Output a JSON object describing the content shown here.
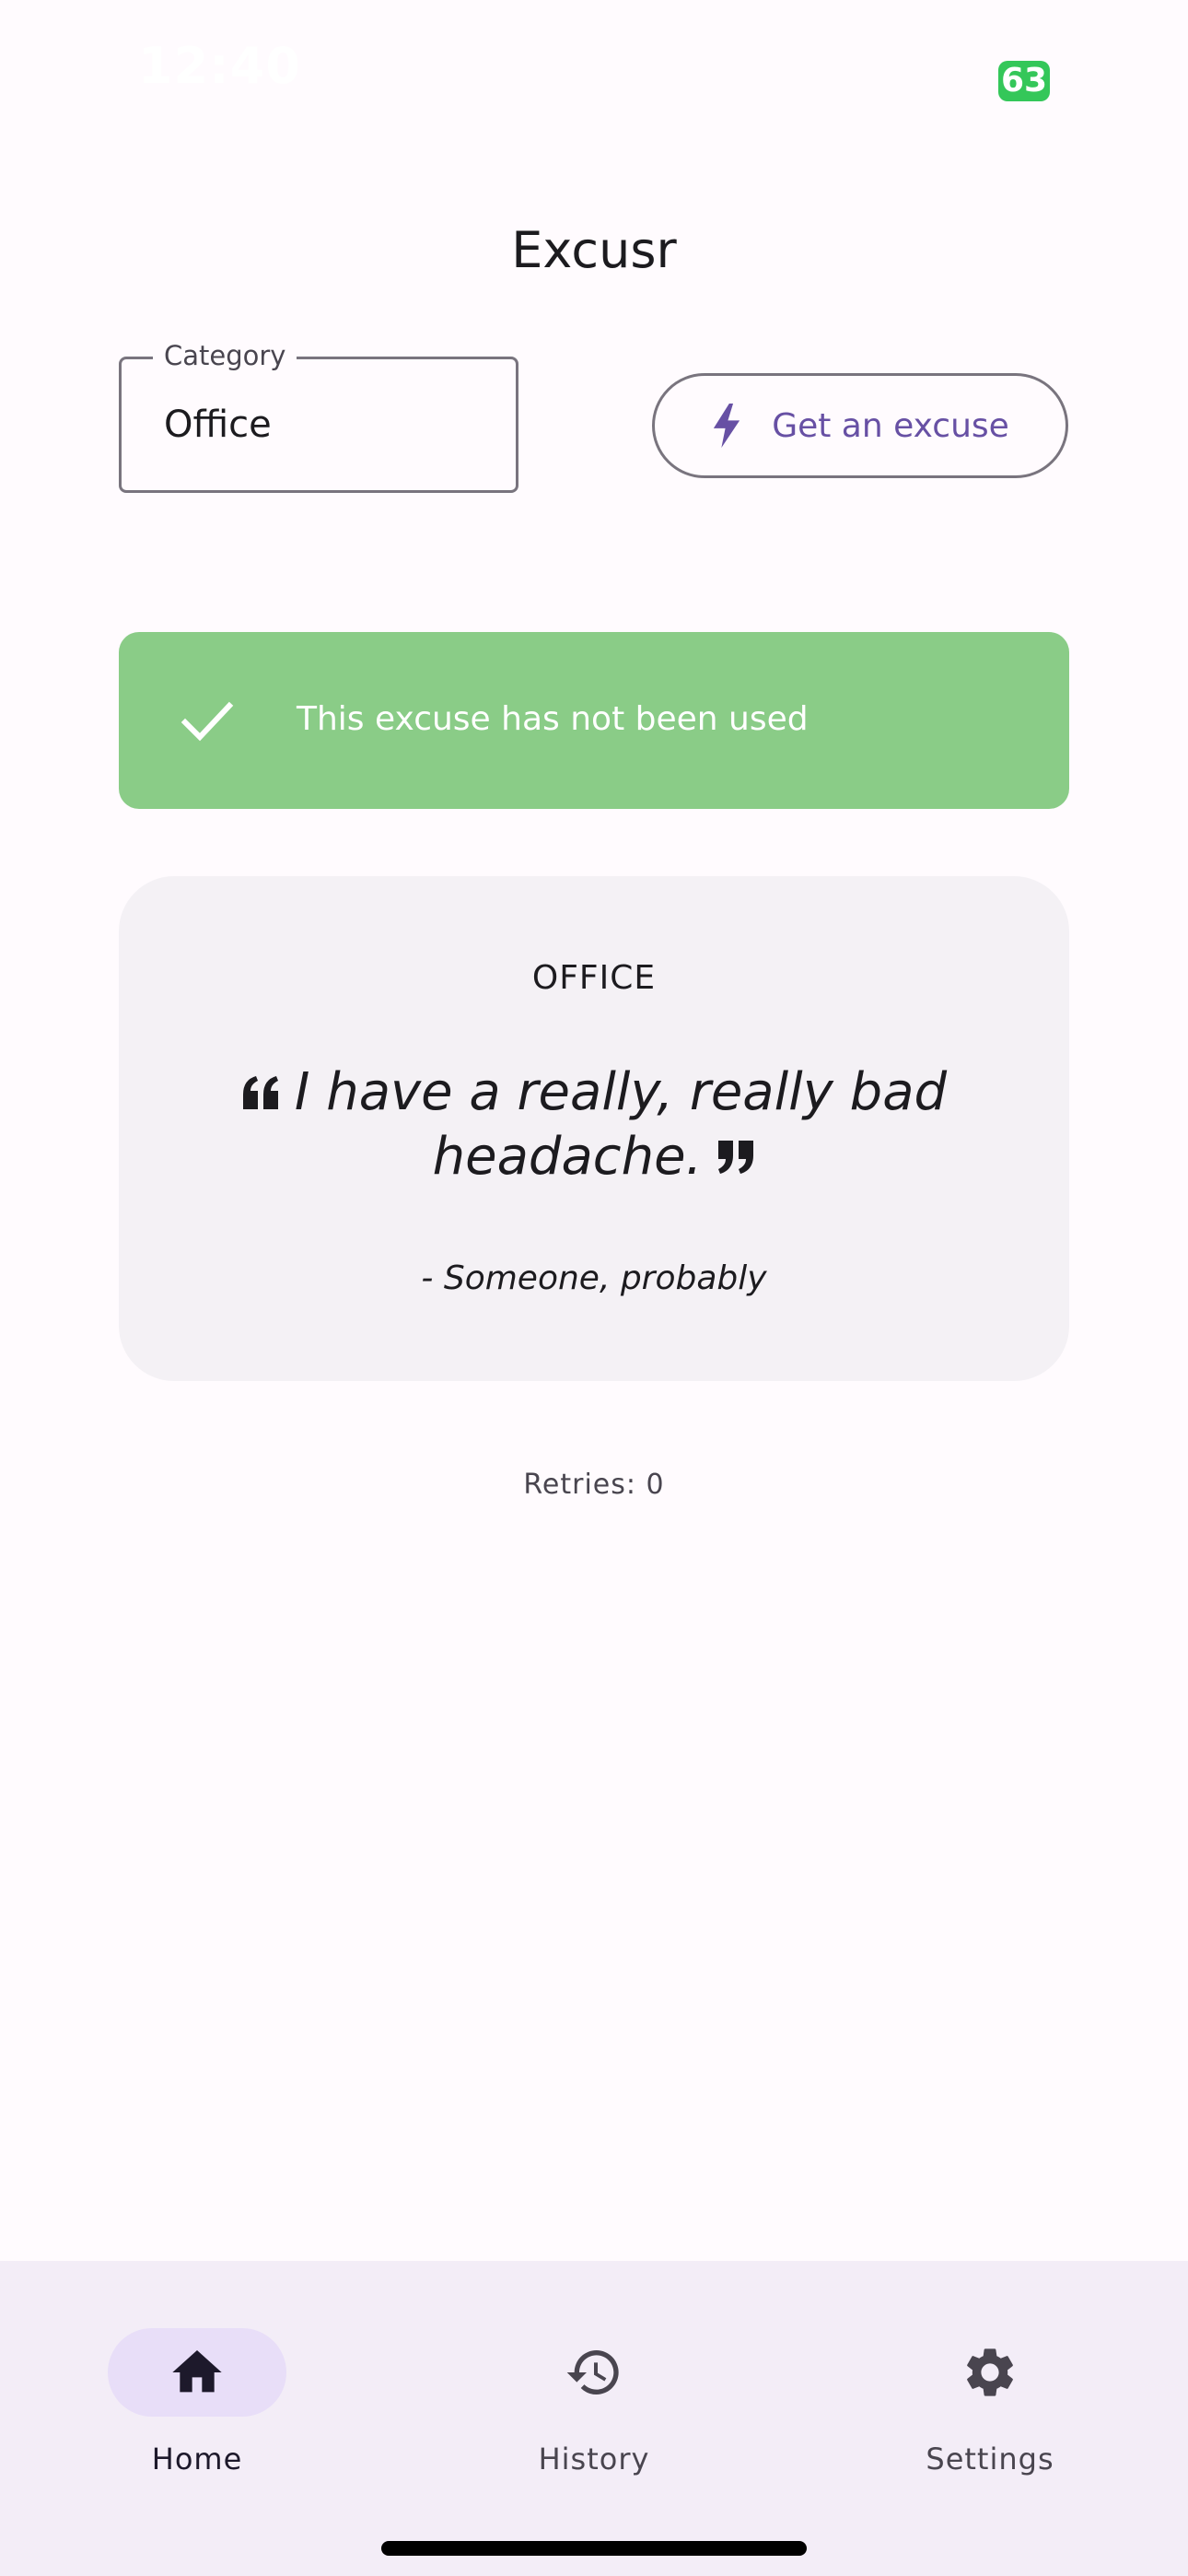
{
  "status_bar": {
    "time": "12:40",
    "battery": "63"
  },
  "app": {
    "title": "Excusr"
  },
  "category": {
    "label": "Category",
    "value": "Office"
  },
  "action": {
    "label": "Get an excuse",
    "icon": "bolt-icon"
  },
  "banner": {
    "text": "This excuse has not been used",
    "icon": "check-icon",
    "color": "#8acc87"
  },
  "quote": {
    "category": "OFFICE",
    "text": "I have a really, really bad headache.",
    "author": "- Someone, probably"
  },
  "retries": "Retries: 0",
  "nav": {
    "items": [
      {
        "label": "Home",
        "icon": "home-icon",
        "active": true
      },
      {
        "label": "History",
        "icon": "history-icon",
        "active": false
      },
      {
        "label": "Settings",
        "icon": "gear-icon",
        "active": false
      }
    ]
  },
  "colors": {
    "accent": "#6750a4",
    "background": "#fffbfe",
    "nav_background": "#f3edf7",
    "active_indicator": "#e8def8"
  }
}
